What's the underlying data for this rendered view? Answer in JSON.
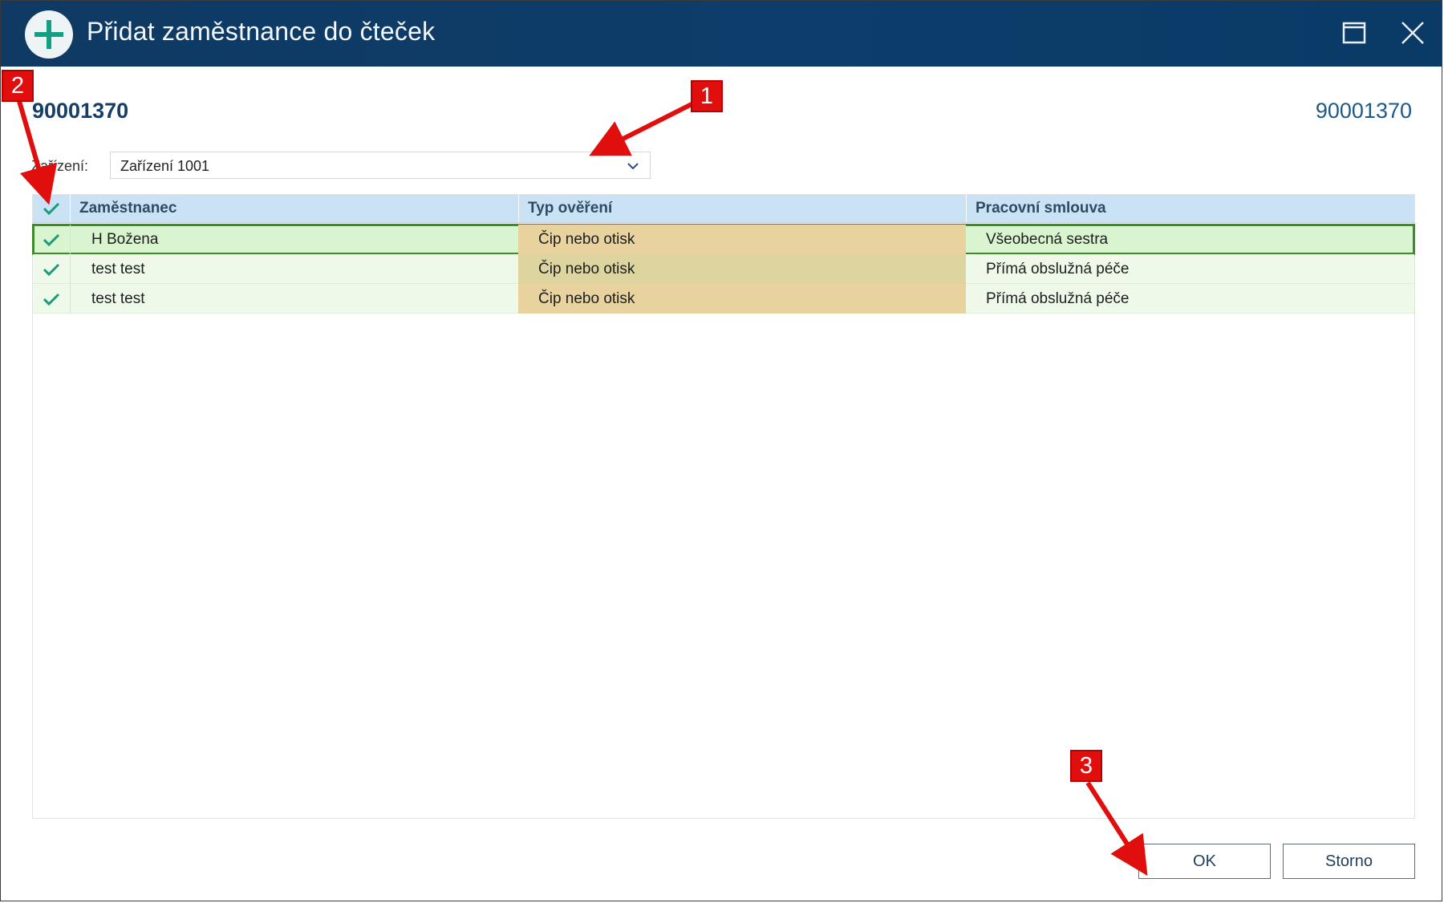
{
  "window": {
    "title": "Přidat zaměstnance do čteček"
  },
  "header": {
    "id_left": "90001370",
    "id_right": "90001370"
  },
  "device": {
    "label": "Zařízení:",
    "selected": "Zařízení 1001"
  },
  "table": {
    "columns": [
      "Zaměstnanec",
      "Typ ověření",
      "Pracovní smlouva"
    ],
    "rows": [
      {
        "checked": true,
        "employee": "H Božena",
        "auth": "Čip nebo otisk",
        "contract": "Všeobecná sestra"
      },
      {
        "checked": true,
        "employee": "test test",
        "auth": "Čip nebo otisk",
        "contract": "Přímá obslužná péče"
      },
      {
        "checked": true,
        "employee": "test test",
        "auth": "Čip nebo otisk",
        "contract": "Přímá obslužná péče"
      }
    ]
  },
  "buttons": {
    "ok": "OK",
    "cancel": "Storno"
  },
  "annotations": [
    "1",
    "2",
    "3"
  ],
  "colors": {
    "titlebar": "#0d3d6a",
    "header": "#c9e2f4",
    "row": "#eef9ea",
    "auth_cell": "#e8d39e",
    "accent": "#1a9b7d",
    "marker": "#e10e0e"
  }
}
